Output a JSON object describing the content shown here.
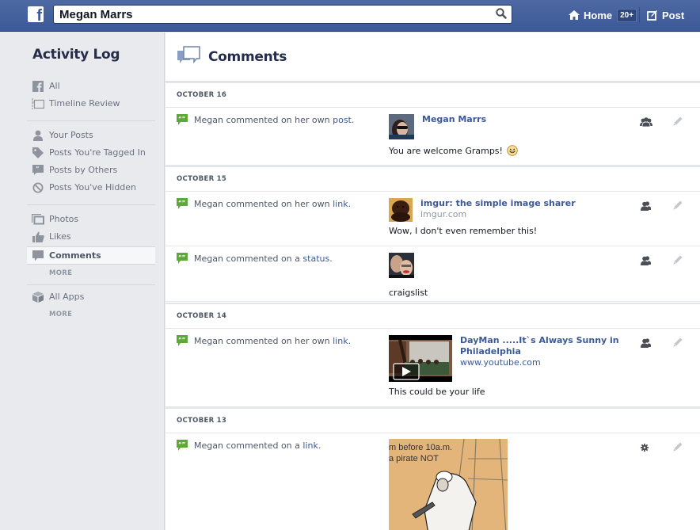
{
  "topbar": {
    "logo": "f",
    "search_value": "Megan Marrs",
    "home_label": "Home",
    "home_badge": "20+",
    "post_label": "Post",
    "colors": {
      "bar": "#3b5998",
      "badge_bg": "#2f477a"
    }
  },
  "sidebar": {
    "title": "Activity Log",
    "group1": [
      {
        "label": "All",
        "icon": "facebook-icon"
      },
      {
        "label": "Timeline Review",
        "icon": "timeline-icon"
      }
    ],
    "group2": [
      {
        "label": "Your Posts",
        "icon": "person-icon"
      },
      {
        "label": "Posts You're Tagged In",
        "icon": "tag-icon"
      },
      {
        "label": "Posts by Others",
        "icon": "quote-bubble-icon"
      },
      {
        "label": "Posts You've Hidden",
        "icon": "hidden-icon"
      }
    ],
    "group3": [
      {
        "label": "Photos",
        "icon": "photos-icon"
      },
      {
        "label": "Likes",
        "icon": "thumbs-up-icon"
      },
      {
        "label": "Comments",
        "icon": "comment-icon",
        "active": true
      }
    ],
    "more_label_1": "MORE",
    "group4": [
      {
        "label": "All Apps",
        "icon": "cube-icon"
      }
    ],
    "more_label_2": "MORE"
  },
  "main": {
    "title": "Comments",
    "sections": [
      {
        "date": "OCTOBER 16",
        "entries": [
          {
            "prefix": "Megan commented on her own ",
            "link": "post",
            "suffix": ".",
            "attachment_title": "Megan Marrs",
            "attachment_sub": "",
            "comment": "You are welcome Gramps!",
            "emoticon": "smiley",
            "audience": "friends"
          }
        ]
      },
      {
        "date": "OCTOBER 15",
        "entries": [
          {
            "prefix": "Megan commented on her own ",
            "link": "link",
            "suffix": ".",
            "attachment_title": "imgur: the simple image sharer",
            "attachment_sub": "imgur.com",
            "comment": "Wow, I don't even remember this!",
            "audience": "friends"
          },
          {
            "prefix": "Megan commented on a ",
            "link": "status",
            "suffix": ".",
            "attachment_title": "",
            "attachment_sub": "",
            "comment": "craigslist",
            "audience": "friends"
          }
        ]
      },
      {
        "date": "OCTOBER 14",
        "entries": [
          {
            "prefix": "Megan commented on her own ",
            "link": "link",
            "suffix": ".",
            "attachment_title": "DayMan .....It`s Always Sunny in Philadelphia",
            "attachment_title_line1": "DayMan .....It`s Always Sunny in",
            "attachment_title_line2": "Philadelphia",
            "attachment_sub": "www.youtube.com",
            "comment": "This could be your life",
            "audience": "friends"
          }
        ]
      },
      {
        "date": "OCTOBER 13",
        "entries": [
          {
            "prefix": "Megan commented on a ",
            "link": "link",
            "suffix": ".",
            "image_text_line1": "m before 10a.m.",
            "image_text_line2": "a pirate NOT",
            "audience": "custom"
          }
        ]
      }
    ]
  }
}
